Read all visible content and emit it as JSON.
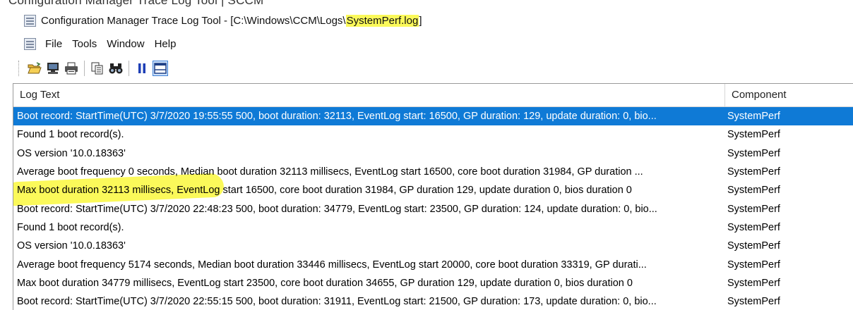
{
  "banner": {
    "text": "Configuration Manager Trace Log Tool | SCCM"
  },
  "window": {
    "title_prefix": "Configuration Manager Trace Log Tool - [C:\\Windows\\CCM\\Logs\\",
    "title_file": "SystemPerf.log",
    "title_suffix": "]"
  },
  "menu": {
    "items": [
      "File",
      "Tools",
      "Window",
      "Help"
    ]
  },
  "toolbar": {
    "icons": [
      "open-folder-icon",
      "monitor-icon",
      "print-icon",
      "copy-icon",
      "find-icon",
      "pause-icon",
      "preview-pane-icon"
    ]
  },
  "table": {
    "columns": [
      "Log Text",
      "Component"
    ],
    "rows": [
      {
        "text": "Boot record: StartTime(UTC) 3/7/2020 19:55:55 500, boot duration: 32113, EventLog start: 16500, GP duration: 129, update duration: 0, bio...",
        "component": "SystemPerf"
      },
      {
        "text": "Found 1 boot record(s).",
        "component": "SystemPerf"
      },
      {
        "text": "OS version '10.0.18363'",
        "component": "SystemPerf"
      },
      {
        "text": "Average boot frequency 0 seconds, Median boot duration 32113 millisecs, EventLog start 16500, core boot duration 31984, GP duration ...",
        "component": "SystemPerf"
      },
      {
        "text": "Max boot duration 32113 millisecs, EventLog start 16500, core boot duration 31984, GP duration 129, update duration 0, bios duration 0",
        "component": "SystemPerf"
      },
      {
        "text": "Boot record: StartTime(UTC) 3/7/2020 22:48:23 500, boot duration: 34779, EventLog start: 23500, GP duration: 124, update duration: 0, bio...",
        "component": "SystemPerf"
      },
      {
        "text": "Found 1 boot record(s).",
        "component": "SystemPerf"
      },
      {
        "text": "OS version '10.0.18363'",
        "component": "SystemPerf"
      },
      {
        "text": "Average boot frequency 5174 seconds, Median boot duration 33446 millisecs, EventLog start 20000, core boot duration 33319, GP durati...",
        "component": "SystemPerf"
      },
      {
        "text": "Max boot duration 34779 millisecs, EventLog start 23500, core boot duration 34655, GP duration 129, update duration 0, bios duration 0",
        "component": "SystemPerf"
      },
      {
        "text": "Boot record: StartTime(UTC) 3/7/2020 22:55:15 500, boot duration: 31911, EventLog start: 21500, GP duration: 173, update duration: 0, bio...",
        "component": "SystemPerf"
      }
    ]
  },
  "colors": {
    "selection": "#0f7ad6",
    "highlight": "#fbf95a"
  }
}
